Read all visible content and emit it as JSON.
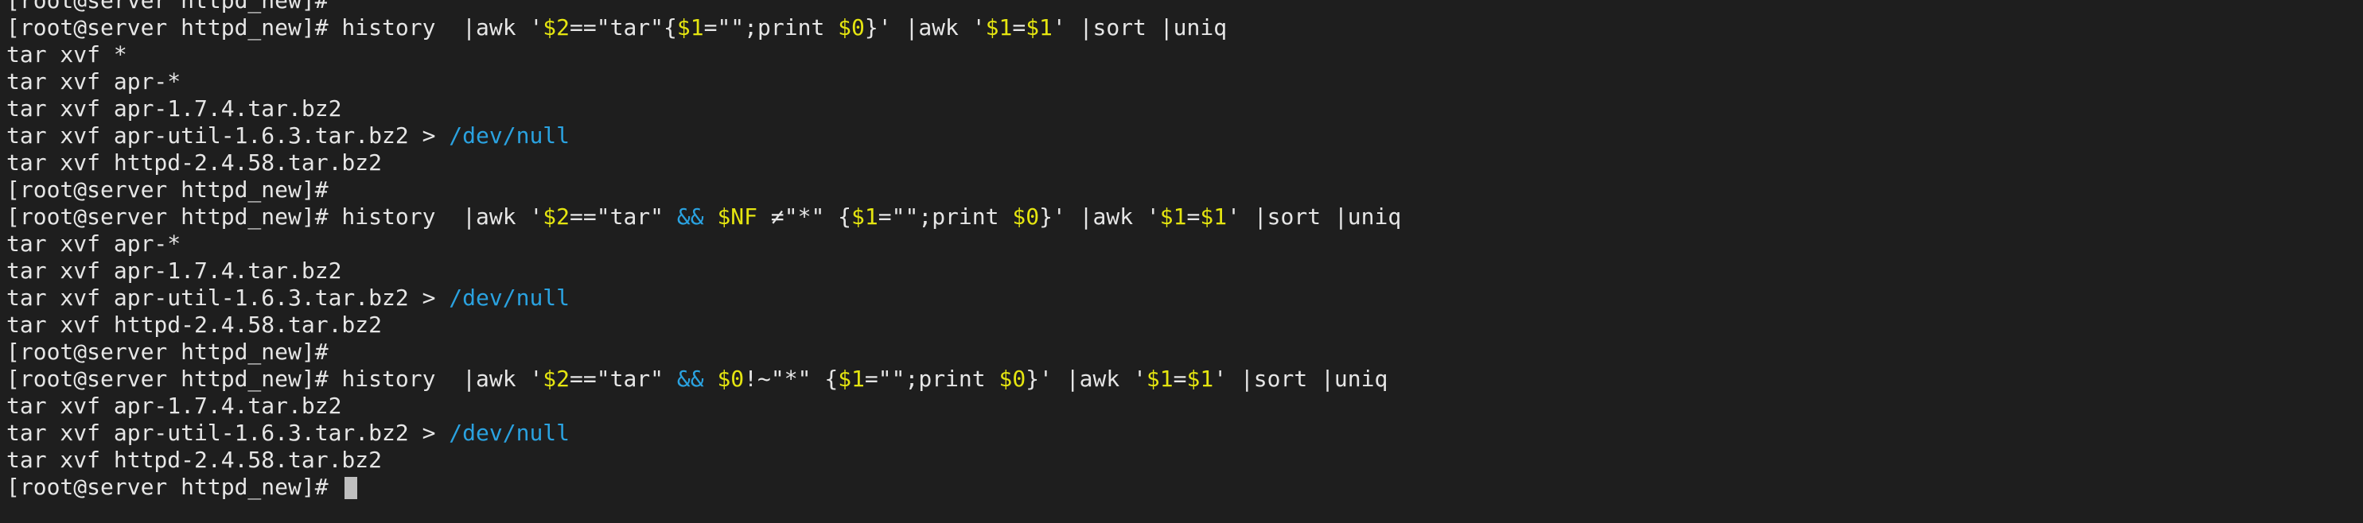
{
  "terminal": {
    "colors": {
      "background": "#1e1e1e",
      "default": "#e6e6e6",
      "yellow": "#e5e510",
      "blue": "#2aa2e0",
      "cursor": "#bfbfbf"
    },
    "lines": [
      {
        "kind": "prompt",
        "segments": [
          {
            "text": "[root@server httpd_new]#",
            "color": "default"
          }
        ]
      },
      {
        "kind": "command",
        "segments": [
          {
            "text": "[root@server httpd_new]# history  |awk '",
            "color": "default"
          },
          {
            "text": "$2",
            "color": "yellow"
          },
          {
            "text": "==\"tar\"{",
            "color": "default"
          },
          {
            "text": "$1",
            "color": "yellow"
          },
          {
            "text": "=\"\";print ",
            "color": "default"
          },
          {
            "text": "$0",
            "color": "yellow"
          },
          {
            "text": "}' |awk '",
            "color": "default"
          },
          {
            "text": "$1",
            "color": "yellow"
          },
          {
            "text": "=",
            "color": "default"
          },
          {
            "text": "$1",
            "color": "yellow"
          },
          {
            "text": "' |sort |uniq",
            "color": "default"
          }
        ]
      },
      {
        "kind": "output",
        "segments": [
          {
            "text": "tar xvf *",
            "color": "default"
          }
        ]
      },
      {
        "kind": "output",
        "segments": [
          {
            "text": "tar xvf apr-*",
            "color": "default"
          }
        ]
      },
      {
        "kind": "output",
        "segments": [
          {
            "text": "tar xvf apr-1.7.4.tar.bz2",
            "color": "default"
          }
        ]
      },
      {
        "kind": "output",
        "segments": [
          {
            "text": "tar xvf apr-util-1.6.3.tar.bz2 > ",
            "color": "default"
          },
          {
            "text": "/dev/null",
            "color": "blue"
          }
        ]
      },
      {
        "kind": "output",
        "segments": [
          {
            "text": "tar xvf httpd-2.4.58.tar.bz2",
            "color": "default"
          }
        ]
      },
      {
        "kind": "prompt",
        "segments": [
          {
            "text": "[root@server httpd_new]#",
            "color": "default"
          }
        ]
      },
      {
        "kind": "command",
        "segments": [
          {
            "text": "[root@server httpd_new]# history  |awk '",
            "color": "default"
          },
          {
            "text": "$2",
            "color": "yellow"
          },
          {
            "text": "==\"tar\" ",
            "color": "default"
          },
          {
            "text": "&&",
            "color": "blue"
          },
          {
            "text": " ",
            "color": "default"
          },
          {
            "text": "$NF",
            "color": "yellow"
          },
          {
            "text": " ≠\"*\" {",
            "color": "default"
          },
          {
            "text": "$1",
            "color": "yellow"
          },
          {
            "text": "=\"\";print ",
            "color": "default"
          },
          {
            "text": "$0",
            "color": "yellow"
          },
          {
            "text": "}' |awk '",
            "color": "default"
          },
          {
            "text": "$1",
            "color": "yellow"
          },
          {
            "text": "=",
            "color": "default"
          },
          {
            "text": "$1",
            "color": "yellow"
          },
          {
            "text": "' |sort |uniq",
            "color": "default"
          }
        ]
      },
      {
        "kind": "output",
        "segments": [
          {
            "text": "tar xvf apr-*",
            "color": "default"
          }
        ]
      },
      {
        "kind": "output",
        "segments": [
          {
            "text": "tar xvf apr-1.7.4.tar.bz2",
            "color": "default"
          }
        ]
      },
      {
        "kind": "output",
        "segments": [
          {
            "text": "tar xvf apr-util-1.6.3.tar.bz2 > ",
            "color": "default"
          },
          {
            "text": "/dev/null",
            "color": "blue"
          }
        ]
      },
      {
        "kind": "output",
        "segments": [
          {
            "text": "tar xvf httpd-2.4.58.tar.bz2",
            "color": "default"
          }
        ]
      },
      {
        "kind": "prompt",
        "segments": [
          {
            "text": "[root@server httpd_new]#",
            "color": "default"
          }
        ]
      },
      {
        "kind": "command",
        "segments": [
          {
            "text": "[root@server httpd_new]# history  |awk '",
            "color": "default"
          },
          {
            "text": "$2",
            "color": "yellow"
          },
          {
            "text": "==\"tar\" ",
            "color": "default"
          },
          {
            "text": "&&",
            "color": "blue"
          },
          {
            "text": " ",
            "color": "default"
          },
          {
            "text": "$0",
            "color": "yellow"
          },
          {
            "text": "!~\"*\" {",
            "color": "default"
          },
          {
            "text": "$1",
            "color": "yellow"
          },
          {
            "text": "=\"\";print ",
            "color": "default"
          },
          {
            "text": "$0",
            "color": "yellow"
          },
          {
            "text": "}' |awk '",
            "color": "default"
          },
          {
            "text": "$1",
            "color": "yellow"
          },
          {
            "text": "=",
            "color": "default"
          },
          {
            "text": "$1",
            "color": "yellow"
          },
          {
            "text": "' |sort |uniq",
            "color": "default"
          }
        ]
      },
      {
        "kind": "output",
        "segments": [
          {
            "text": "tar xvf apr-1.7.4.tar.bz2",
            "color": "default"
          }
        ]
      },
      {
        "kind": "output",
        "segments": [
          {
            "text": "tar xvf apr-util-1.6.3.tar.bz2 > ",
            "color": "default"
          },
          {
            "text": "/dev/null",
            "color": "blue"
          }
        ]
      },
      {
        "kind": "output",
        "segments": [
          {
            "text": "tar xvf httpd-2.4.58.tar.bz2",
            "color": "default"
          }
        ]
      },
      {
        "kind": "prompt-active",
        "segments": [
          {
            "text": "[root@server httpd_new]# ",
            "color": "default"
          }
        ]
      }
    ]
  }
}
